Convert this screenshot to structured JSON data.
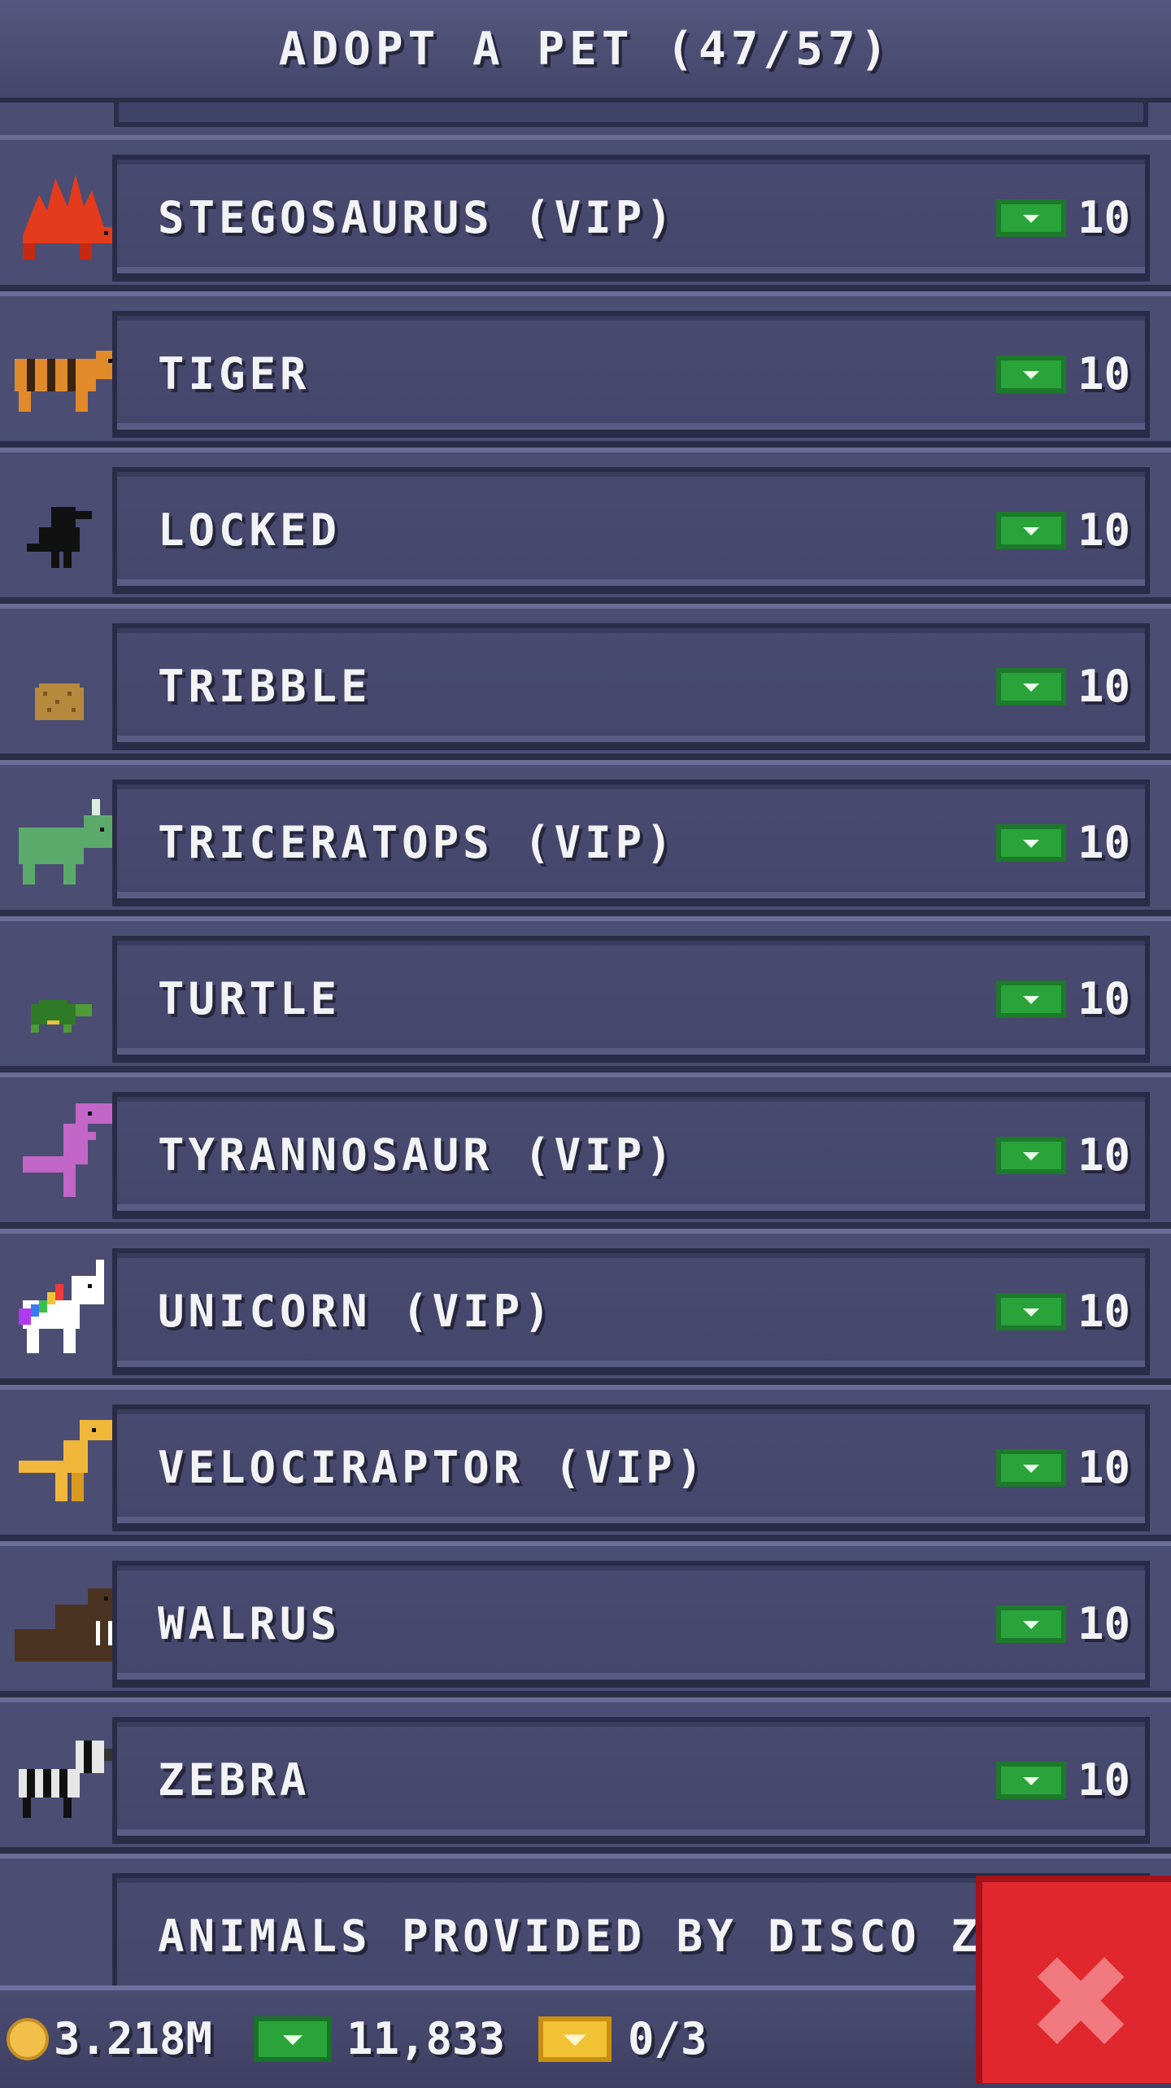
{
  "header": {
    "title": "ADOPT A PET (47/57)"
  },
  "pets": [
    {
      "name": "STEGOSAURUS (VIP)",
      "price": "10",
      "icon": "stegosaurus-icon",
      "color": "#e53b1d"
    },
    {
      "name": "TIGER",
      "price": "10",
      "icon": "tiger-icon",
      "color": "#e08a2c"
    },
    {
      "name": "LOCKED",
      "price": "10",
      "icon": "locked-silhouette-icon",
      "color": "#111111"
    },
    {
      "name": "TRIBBLE",
      "price": "10",
      "icon": "tribble-icon",
      "color": "#b7893d"
    },
    {
      "name": "TRICERATOPS (VIP)",
      "price": "10",
      "icon": "triceratops-icon",
      "color": "#5caa6b"
    },
    {
      "name": "TURTLE",
      "price": "10",
      "icon": "turtle-icon",
      "color": "#2f7a27"
    },
    {
      "name": "TYRANNOSAUR (VIP)",
      "price": "10",
      "icon": "tyrannosaur-icon",
      "color": "#c266c7"
    },
    {
      "name": "UNICORN (VIP)",
      "price": "10",
      "icon": "unicorn-icon",
      "color": "#ffffff"
    },
    {
      "name": "VELOCIRAPTOR (VIP)",
      "price": "10",
      "icon": "velociraptor-icon",
      "color": "#f0b73a"
    },
    {
      "name": "WALRUS",
      "price": "10",
      "icon": "walrus-icon",
      "color": "#4a3321"
    },
    {
      "name": "ZEBRA",
      "price": "10",
      "icon": "zebra-icon",
      "color": "#e6e6e6"
    }
  ],
  "credits": {
    "text": "ANIMALS PROVIDED BY DISCO ZOO"
  },
  "footer": {
    "coins": "3.218M",
    "bucks": "11,833",
    "tickets": "0/3"
  },
  "close_button": {
    "icon": "close-icon",
    "color": "#e0272d"
  }
}
